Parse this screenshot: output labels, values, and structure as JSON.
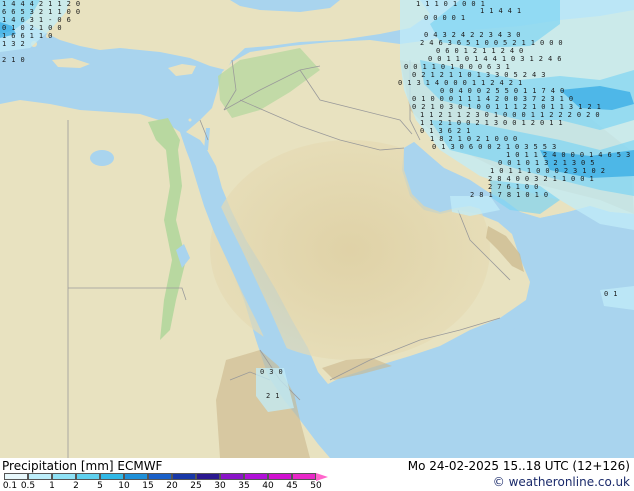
{
  "footer": {
    "title": "Precipitation [mm] ECMWF",
    "datetime": "Mo 24-02-2025 15..18 UTC (12+126)",
    "copyright": "© weatheronline.co.uk"
  },
  "scale": {
    "labels": [
      "0.1",
      "0.5",
      "1",
      "2",
      "5",
      "10",
      "15",
      "20",
      "25",
      "30",
      "35",
      "40",
      "45",
      "50"
    ],
    "colors": [
      "#e8f8fc",
      "#bdeefa",
      "#8fe2f6",
      "#5fd0ee",
      "#30b8e6",
      "#1e90d8",
      "#1a60c8",
      "#1838a8",
      "#2a1890",
      "#8a14c8",
      "#b010d8",
      "#d010d0",
      "#e828c8",
      "#ff66cc"
    ]
  },
  "map": {
    "colors": {
      "sea": "#a9d4ee",
      "land": "#e8e2c0",
      "desert": "#ddd0a4",
      "mountain": "#cbb88c",
      "green": "#b8d8a0",
      "border": "#9a9a9a",
      "precip_light": "#c2ecf8",
      "precip_med": "#7fd4f2",
      "precip_heavy": "#2fa8e4"
    },
    "precip_rows": [
      {
        "id": "r01",
        "text": "1 4 4 4 2 1 1 2 0"
      },
      {
        "id": "r02",
        "text": "6 6 5 3 2 1 1 0 0"
      },
      {
        "id": "r03",
        "text": "1 4 6 3 1 - 0 6"
      },
      {
        "id": "r04",
        "text": "0 1 0 2 1 0 0"
      },
      {
        "id": "r05",
        "text": "1 6 6 1 1 0"
      },
      {
        "id": "r06",
        "text": "1 3 2"
      },
      {
        "id": "r07",
        "text": "2 1 0"
      },
      {
        "id": "r08",
        "text": "1 1 1 0 1 0 0 1"
      },
      {
        "id": "r09",
        "text": "1 1 4 4 1"
      },
      {
        "id": "r10",
        "text": "0 0 0 0 1"
      },
      {
        "id": "r11",
        "text": "0 4 3 2 4 2 2 3 4 3 0"
      },
      {
        "id": "r12",
        "text": "2 4 6 3 6 5 1 0 0 5 2 1 1 0 0 0"
      },
      {
        "id": "r13",
        "text": "0 6 0 1 2 1 1 2 4 0"
      },
      {
        "id": "r14",
        "text": "0 0 1 1 0 1 4 4 1 0 3 1 2 4 6"
      },
      {
        "id": "r15",
        "text": "0 0 1 1 0 1 0 0 0 6 3 1"
      },
      {
        "id": "r16",
        "text": "0 2 1 2 1 1 0 1 3 3 0 5 2 4 3"
      },
      {
        "id": "r17",
        "text": "0 1 3 1 4 0 0 0 1 1 2 4 2 1"
      },
      {
        "id": "r18",
        "text": "0 0 4 0 0 2 5 5 0 1 1 7 4 0"
      },
      {
        "id": "r19",
        "text": "0 1 0 0 0 1 1 1 4 2 0 0 3 7 2 3 1 0"
      },
      {
        "id": "r20",
        "text": "0 2 1 0 3 0 1 0 0 1 1 1 2 1 0 1 1 3 1 2 1"
      },
      {
        "id": "r21",
        "text": "1 1 2 1 1 2 3 0 1 0 0 0 1 1 2 2 2 0 2 0"
      },
      {
        "id": "r22",
        "text": "1 1 2 1 0 0 2 1 3 0 0 1 2 0 1 1"
      },
      {
        "id": "r23",
        "text": "0 1 3 6 2 1"
      },
      {
        "id": "r24",
        "text": "1 8 2 1 0 2 1 0 0 0"
      },
      {
        "id": "r25",
        "text": "0 1 3 0 6 0 0 2 1 0 3 5 5 3"
      },
      {
        "id": "r26",
        "text": "1 0 1 1 2 4 0 0 0 1 4 6 5 3"
      },
      {
        "id": "r27",
        "text": "0 0 1 0 1 3 2 1 3 0 5"
      },
      {
        "id": "r28",
        "text": "1 0 1 1 1 0 0 0 2 3 1 0 2"
      },
      {
        "id": "r29",
        "text": "2 8 4 0 0 3 2 1 1 0 0 1"
      },
      {
        "id": "r30",
        "text": "2 7 6 1 0 0"
      },
      {
        "id": "r31",
        "text": "2 8 1 7 8 1 0 1 0"
      },
      {
        "id": "r32",
        "text": "0 3 0"
      },
      {
        "id": "r33",
        "text": "2 1"
      },
      {
        "id": "r34",
        "text": "0 1"
      }
    ]
  }
}
